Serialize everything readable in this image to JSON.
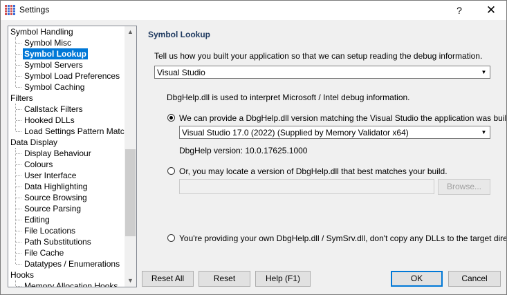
{
  "window": {
    "title": "Settings",
    "help_glyph": "?",
    "close_glyph": "✕"
  },
  "tree": {
    "categories": [
      {
        "label": "Symbol Handling",
        "children": [
          {
            "label": "Symbol Misc"
          },
          {
            "label": "Symbol Lookup",
            "selected": true
          },
          {
            "label": "Symbol Servers"
          },
          {
            "label": "Symbol Load Preferences"
          },
          {
            "label": "Symbol Caching"
          }
        ]
      },
      {
        "label": "Filters",
        "children": [
          {
            "label": "Callstack Filters"
          },
          {
            "label": "Hooked DLLs"
          },
          {
            "label": "Load Settings Pattern Match"
          }
        ]
      },
      {
        "label": "Data Display",
        "children": [
          {
            "label": "Display Behaviour"
          },
          {
            "label": "Colours"
          },
          {
            "label": "User Interface"
          },
          {
            "label": "Data Highlighting"
          },
          {
            "label": "Source Browsing"
          },
          {
            "label": "Source Parsing"
          },
          {
            "label": "Editing"
          },
          {
            "label": "File Locations"
          },
          {
            "label": "Path Substitutions"
          },
          {
            "label": "File Cache"
          },
          {
            "label": "Datatypes / Enumerations"
          }
        ]
      },
      {
        "label": "Hooks",
        "children": [
          {
            "label": "Memory Allocation Hooks"
          }
        ]
      }
    ],
    "scroll_up": "▲",
    "scroll_down": "▼"
  },
  "panel": {
    "title": "Symbol Lookup",
    "intro": "Tell us how you built your application so that we can setup reading the debug information.",
    "build_combo": {
      "value": "Visual Studio",
      "arrow": "▼"
    },
    "dbghelp_info": "DbgHelp.dll is used to interpret Microsoft / Intel debug information.",
    "option_provide": {
      "label": "We can provide a DbgHelp.dll version matching the Visual Studio the application was built with.",
      "checked": true
    },
    "version_combo": {
      "value": "Visual Studio 17.0 (2022) (Supplied by  Memory Validator x64)",
      "arrow": "▼"
    },
    "dbghelp_version": "DbgHelp version: 10.0.17625.1000",
    "option_locate": {
      "label": "Or, you may locate a version of DbgHelp.dll that best matches your build.",
      "checked": false
    },
    "locate_path": {
      "value": "",
      "placeholder": ""
    },
    "browse_label": "Browse...",
    "option_own": {
      "label": "You're providing your own DbgHelp.dll / SymSrv.dll, don't copy any DLLs to the target directory",
      "checked": false
    }
  },
  "footer": {
    "reset_all": "Reset All",
    "reset": "Reset",
    "help": "Help (F1)",
    "ok": "OK",
    "cancel": "Cancel"
  }
}
